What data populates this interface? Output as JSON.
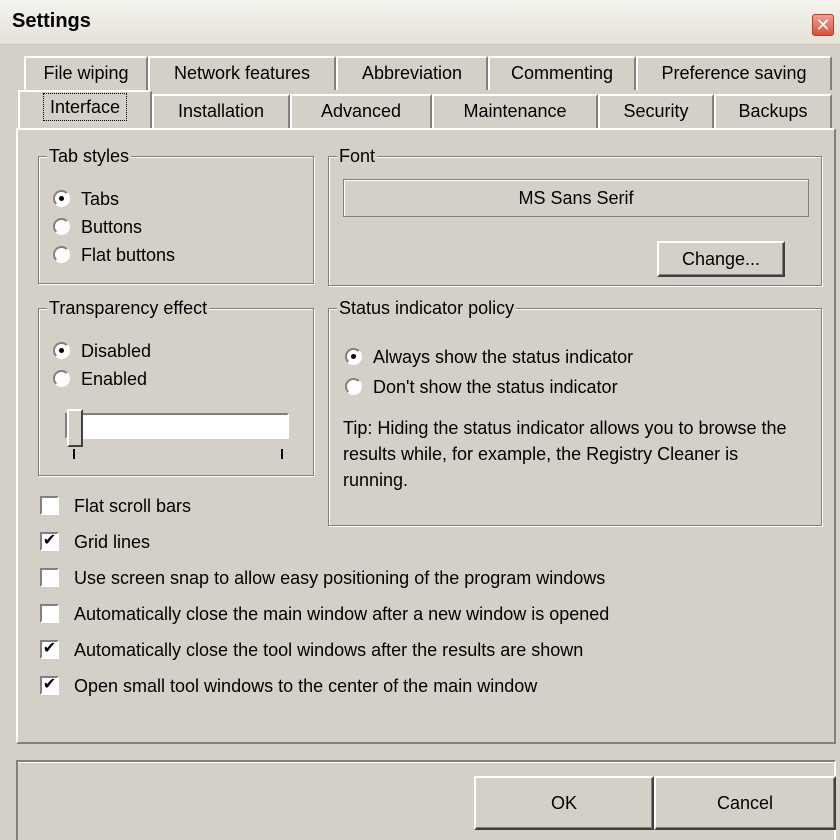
{
  "window": {
    "title": "Settings"
  },
  "tabs_row1": [
    "File wiping",
    "Network features",
    "Abbreviation",
    "Commenting",
    "Preference saving"
  ],
  "tabs_row2": [
    "Interface",
    "Installation",
    "Advanced",
    "Maintenance",
    "Security",
    "Backups"
  ],
  "active_tab": "Interface",
  "tab_styles": {
    "legend": "Tab styles",
    "options": [
      "Tabs",
      "Buttons",
      "Flat buttons"
    ],
    "selected": "Tabs"
  },
  "font": {
    "legend": "Font",
    "value": "MS Sans Serif",
    "change_label": "Change..."
  },
  "transparency": {
    "legend": "Transparency effect",
    "options": [
      "Disabled",
      "Enabled"
    ],
    "selected": "Disabled",
    "slider_level": 0
  },
  "status_policy": {
    "legend": "Status indicator policy",
    "options": [
      "Always show the status indicator",
      "Don't show the status indicator"
    ],
    "selected": "Always show the status indicator",
    "tip": "Tip: Hiding the status indicator allows you to browse the results while, for example, the Registry Cleaner is running."
  },
  "checkboxes": [
    {
      "label": "Flat scroll bars",
      "checked": false
    },
    {
      "label": "Grid lines",
      "checked": true
    },
    {
      "label": "Use screen snap to allow easy positioning of the program windows",
      "checked": false
    },
    {
      "label": "Automatically close the main window after a new window is opened",
      "checked": false
    },
    {
      "label": "Automatically close the tool windows after the results are shown",
      "checked": true
    },
    {
      "label": "Open small tool windows to the center of the main window",
      "checked": true
    }
  ],
  "buttons": {
    "ok": "OK",
    "cancel": "Cancel"
  },
  "icons": {
    "close": "close-icon",
    "check": "check-mark-icon"
  },
  "colors": {
    "face": "#d4d0c8",
    "close": "#d9503a"
  }
}
